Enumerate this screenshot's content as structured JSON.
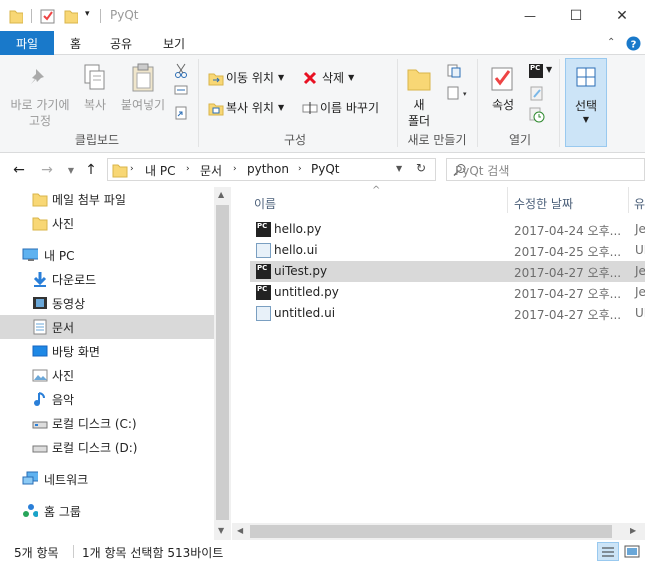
{
  "window": {
    "title": "PyQt",
    "minimize": "—",
    "maximize": "☐",
    "close": "✕"
  },
  "ribbon_tabs": {
    "file": "파일",
    "home": "홈",
    "share": "공유",
    "view": "보기"
  },
  "ribbon": {
    "clipboard": {
      "label": "클립보드",
      "pin": "바로 가기에",
      "pin2": "고정",
      "copy": "복사",
      "paste": "붙여넣기"
    },
    "organize": {
      "label": "구성",
      "move_to": "이동 위치",
      "delete": "삭제",
      "copy_to": "복사 위치",
      "rename": "이름 바꾸기"
    },
    "new": {
      "label": "새로 만들기",
      "new_folder": "새",
      "new_folder2": "폴더"
    },
    "open": {
      "label": "열기",
      "properties": "속성"
    },
    "select": {
      "label": "선택"
    }
  },
  "address": {
    "crumbs": [
      "내 PC",
      "문서",
      "python",
      "PyQt"
    ],
    "search_placeholder": "PyQt 검색"
  },
  "nav": {
    "items": [
      {
        "label": "메일 첨부 파일",
        "icon": "folder-icon"
      },
      {
        "label": "사진",
        "icon": "folder-icon"
      },
      {
        "label": "내 PC",
        "icon": "computer-icon"
      },
      {
        "label": "다운로드",
        "icon": "download-icon"
      },
      {
        "label": "동영상",
        "icon": "video-icon"
      },
      {
        "label": "문서",
        "icon": "document-icon"
      },
      {
        "label": "바탕 화면",
        "icon": "desktop-icon"
      },
      {
        "label": "사진",
        "icon": "pictures-icon"
      },
      {
        "label": "음악",
        "icon": "music-icon"
      },
      {
        "label": "로컬 디스크 (C:)",
        "icon": "drive-icon"
      },
      {
        "label": "로컬 디스크 (D:)",
        "icon": "drive-icon"
      },
      {
        "label": "네트워크",
        "icon": "network-icon"
      },
      {
        "label": "홈 그룹",
        "icon": "homegroup-icon"
      }
    ]
  },
  "columns": {
    "name": "이름",
    "date": "수정한 날짜",
    "type": "유"
  },
  "files": [
    {
      "name": "hello.py",
      "date": "2017-04-24 오후...",
      "type": "Jet",
      "kind": "py"
    },
    {
      "name": "hello.ui",
      "date": "2017-04-25 오후...",
      "type": "UI",
      "kind": "ui"
    },
    {
      "name": "uiTest.py",
      "date": "2017-04-27 오후...",
      "type": "Jet",
      "kind": "py"
    },
    {
      "name": "untitled.py",
      "date": "2017-04-27 오후...",
      "type": "Jet",
      "kind": "py"
    },
    {
      "name": "untitled.ui",
      "date": "2017-04-27 오후...",
      "type": "UI",
      "kind": "ui"
    }
  ],
  "status": {
    "count": "5개 항목",
    "selection": "1개 항목 선택함 513바이트"
  },
  "colors": {
    "accent": "#1979ca",
    "selection": "#d9d9d9",
    "folder": "#f8d775",
    "delete": "#e81123"
  }
}
